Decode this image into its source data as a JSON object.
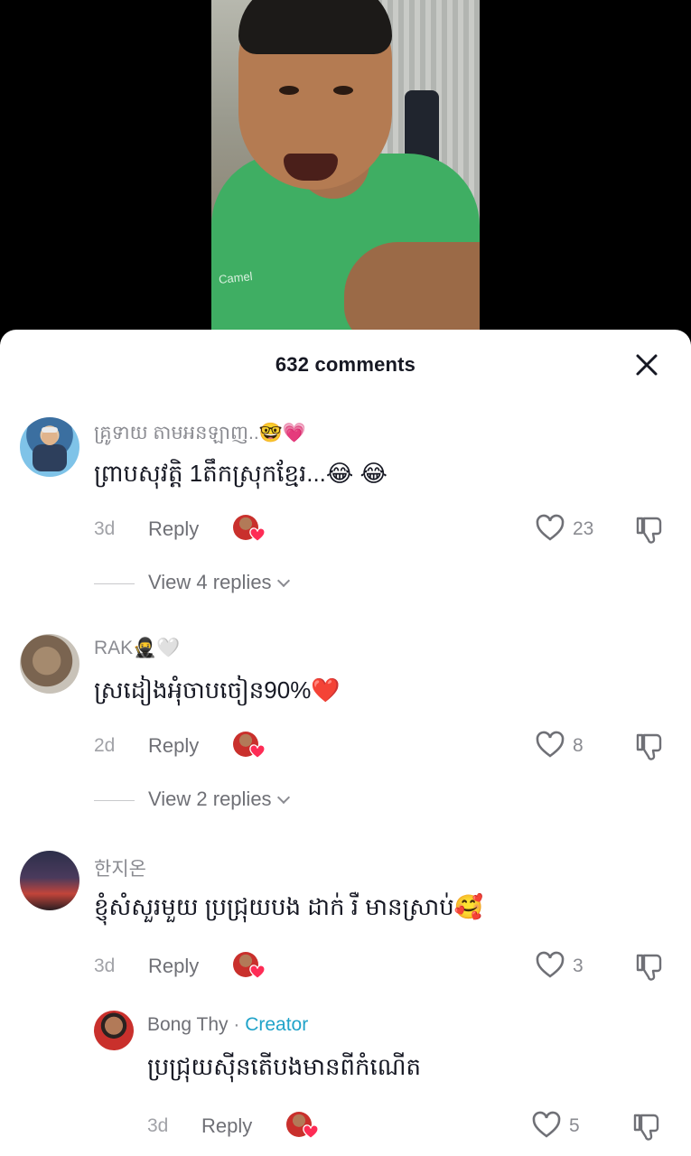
{
  "header": {
    "title": "632 comments"
  },
  "comments": [
    {
      "username": "គ្រូទាយ តាមអនឡាញ..🤓💗",
      "text": "ព្រាបសុវត្តិ 1តឹកស្រុកខ្មែរ...😂 😂",
      "time": "3d",
      "reply_label": "Reply",
      "likes": "23",
      "view_replies": "View 4 replies"
    },
    {
      "username": "RAK🥷🤍",
      "text": "ស្រដៀងអ៉ំចាបចៀន90%❤️",
      "time": "2d",
      "reply_label": "Reply",
      "likes": "8",
      "view_replies": "View 2 replies"
    },
    {
      "username": "한지온",
      "text": "ខ្ញុំសំសួរមួយ ប្រជ្រុយបង ដាក់ រឺ មានស្រាប់🥰",
      "time": "3d",
      "reply_label": "Reply",
      "likes": "3"
    }
  ],
  "reply": {
    "username": "Bong Thy",
    "separator": "·",
    "creator_label": "Creator",
    "text": "ប្រជ្រុយស៊ីនតើបងមានពីកំណើត",
    "time": "3d",
    "reply_label": "Reply",
    "likes": "5"
  },
  "video": {
    "shirt_text": "Camel"
  },
  "colors": {
    "creator": "#20a3c9",
    "heart": "#fe2c55",
    "text": "#161823",
    "muted": "#8a8b91"
  }
}
